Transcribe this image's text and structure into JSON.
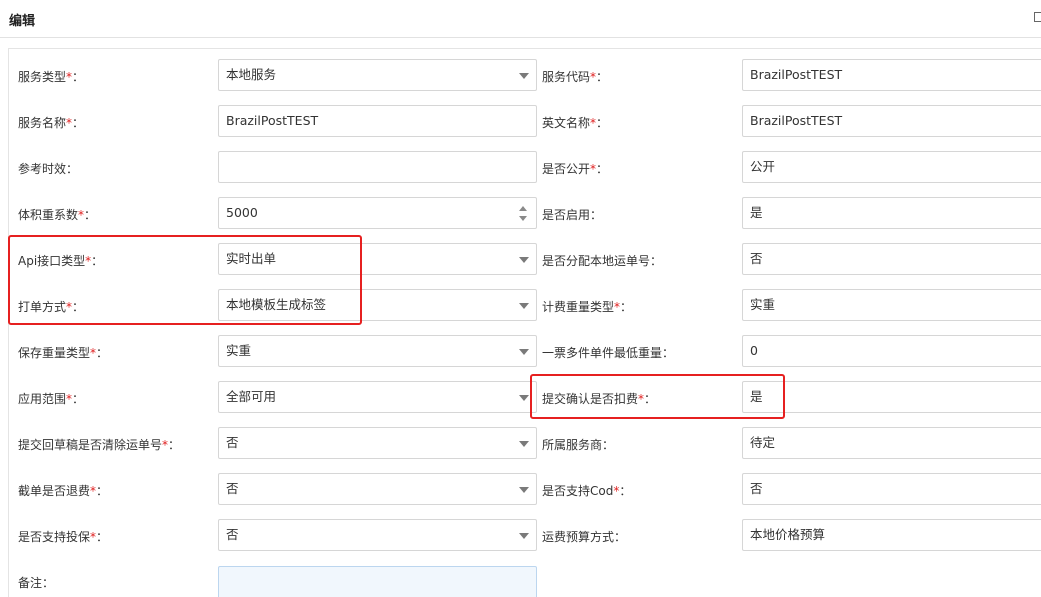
{
  "window": {
    "title": "编辑"
  },
  "form": {
    "rows": [
      {
        "left": {
          "label": "服务类型",
          "required": true,
          "value": "本地服务",
          "type": "select"
        },
        "right": {
          "label": "服务代码",
          "required": true,
          "value": "BrazilPostTEST",
          "type": "text"
        }
      },
      {
        "left": {
          "label": "服务名称",
          "required": true,
          "value": "BrazilPostTEST",
          "type": "text"
        },
        "right": {
          "label": "英文名称",
          "required": true,
          "value": "BrazilPostTEST",
          "type": "text"
        }
      },
      {
        "left": {
          "label": "参考时效",
          "required": false,
          "value": "",
          "type": "text"
        },
        "right": {
          "label": "是否公开",
          "required": true,
          "value": "公开",
          "type": "text"
        }
      },
      {
        "left": {
          "label": "体积重系数",
          "required": true,
          "value": "5000",
          "type": "number"
        },
        "right": {
          "label": "是否启用",
          "required": false,
          "value": "是",
          "type": "text"
        }
      },
      {
        "left": {
          "label": "Api接口类型",
          "required": true,
          "value": "实时出单",
          "type": "select"
        },
        "right": {
          "label": "是否分配本地运单号",
          "required": false,
          "value": "否",
          "type": "text"
        }
      },
      {
        "left": {
          "label": "打单方式",
          "required": true,
          "value": "本地模板生成标签",
          "type": "select"
        },
        "right": {
          "label": "计费重量类型",
          "required": true,
          "value": "实重",
          "type": "text"
        }
      },
      {
        "left": {
          "label": "保存重量类型",
          "required": true,
          "value": "实重",
          "type": "select"
        },
        "right": {
          "label": "一票多件单件最低重量",
          "required": false,
          "value": "0",
          "type": "text"
        }
      },
      {
        "left": {
          "label": "应用范围",
          "required": true,
          "value": "全部可用",
          "type": "select"
        },
        "right": {
          "label": "提交确认是否扣费",
          "required": true,
          "value": "是",
          "type": "text"
        }
      },
      {
        "left": {
          "label": "提交回草稿是否清除运单号",
          "required": true,
          "value": "否",
          "type": "select"
        },
        "right": {
          "label": "所属服务商",
          "required": false,
          "value": "待定",
          "type": "text"
        }
      },
      {
        "left": {
          "label": "截单是否退费",
          "required": true,
          "value": "否",
          "type": "select"
        },
        "right": {
          "label": "是否支持Cod",
          "required": true,
          "value": "否",
          "type": "text"
        }
      },
      {
        "left": {
          "label": "是否支持投保",
          "required": true,
          "value": "否",
          "type": "select"
        },
        "right": {
          "label": "运费预算方式",
          "required": false,
          "value": "本地价格预算",
          "type": "text"
        }
      }
    ],
    "remarks": {
      "label": "备注",
      "value": ""
    },
    "required_mark": "*",
    "colon": "："
  },
  "colors": {
    "required": "#e02020",
    "highlight": "#e62020",
    "border": "#d6d6d6"
  }
}
